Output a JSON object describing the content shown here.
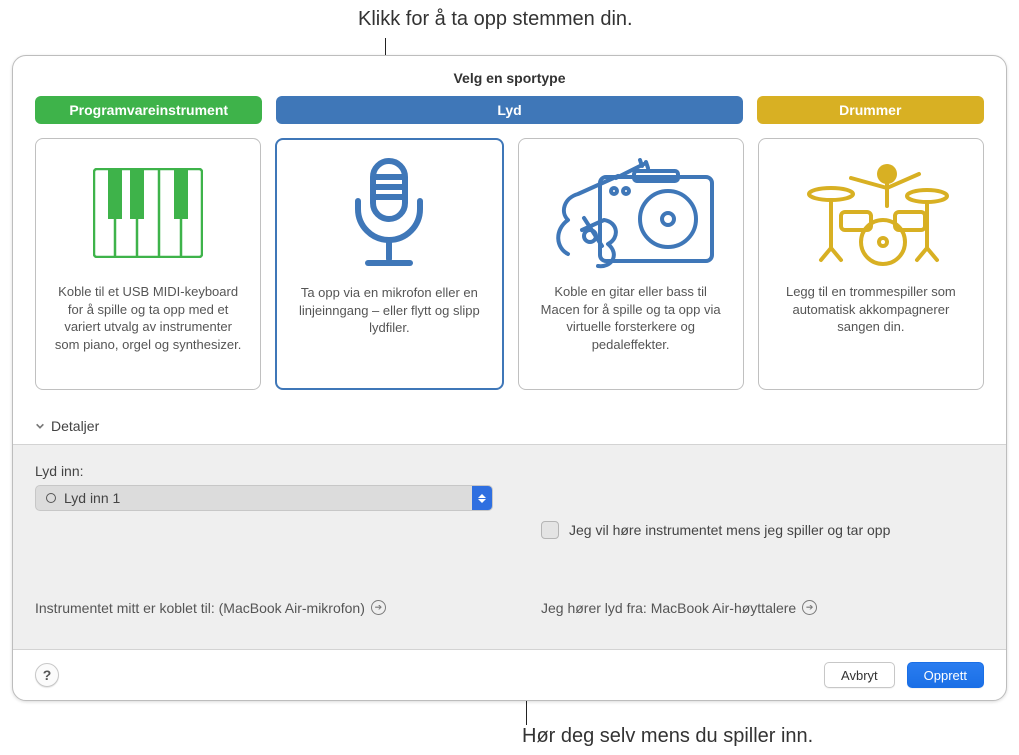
{
  "annotations": {
    "top": "Klikk for å ta opp stemmen din.",
    "bottom": "Hør deg selv mens du spiller inn."
  },
  "header": {
    "title": "Velg en sportype"
  },
  "segments": {
    "software": "Programvareinstrument",
    "audio": "Lyd",
    "drummer": "Drummer"
  },
  "cards": {
    "software": {
      "desc": "Koble til et USB MIDI-keyboard for å spille og ta opp med et variert utvalg av instrumenter som piano, orgel og synthesizer."
    },
    "mic": {
      "desc": "Ta opp via en mikrofon eller en linjeinngang – eller flytt og slipp lydfiler."
    },
    "guitar": {
      "desc": "Koble en gitar eller bass til Macen for å spille og ta opp via virtuelle forsterkere og pedaleffekter."
    },
    "drummer": {
      "desc": "Legg til en trommespiller som automatisk akkompagnerer sangen din."
    }
  },
  "details_label": "Detaljer",
  "lower": {
    "audio_in_label": "Lyd inn:",
    "audio_in_value": "Lyd inn 1",
    "monitor_label": "Jeg vil høre instrumentet mens jeg spiller og tar opp",
    "instrument_connected": "Instrumentet mitt er koblet til: (MacBook Air-mikrofon)",
    "hear_from": "Jeg hører lyd fra: MacBook Air-høyttalere"
  },
  "footer": {
    "help": "?",
    "cancel": "Avbryt",
    "create": "Opprett"
  }
}
